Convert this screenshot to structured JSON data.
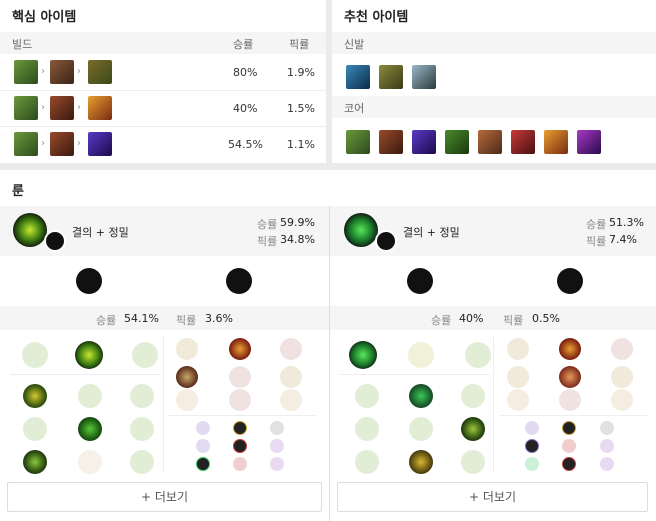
{
  "core_items": {
    "title": "핵심 아이템",
    "col_build": "빌드",
    "col_winrate": "승률",
    "col_pickrate": "픽률",
    "rows": [
      {
        "winrate": "80%",
        "pickrate": "1.9%"
      },
      {
        "winrate": "40%",
        "pickrate": "1.5%"
      },
      {
        "winrate": "54.5%",
        "pickrate": "1.1%"
      }
    ]
  },
  "recommended_items": {
    "title": "추천 아이템",
    "boots_label": "신발",
    "core_label": "코어"
  },
  "runes": {
    "title": "룬",
    "pages": [
      {
        "tree_label": "결의 + 정밀",
        "winrate_label": "승률",
        "winrate": "59.9%",
        "pickrate_label": "픽률",
        "pickrate": "34.8%",
        "stat_winrate": "54.1%",
        "stat_pickrate": "3.6%",
        "more_button": "+ 더보기"
      },
      {
        "tree_label": "결의 + 정밀",
        "winrate_label": "승률",
        "winrate": "51.3%",
        "pickrate_label": "픽률",
        "pickrate": "7.4%",
        "stat_winrate": "40%",
        "stat_pickrate": "0.5%",
        "more_button": "+ 더보기"
      }
    ],
    "stat_winrate_label": "승률",
    "stat_pickrate_label": "픽률"
  },
  "colors": {
    "accent_green": "#4caf50",
    "header_bg": "#f5f5f5",
    "page_bg": "#ebebeb"
  }
}
